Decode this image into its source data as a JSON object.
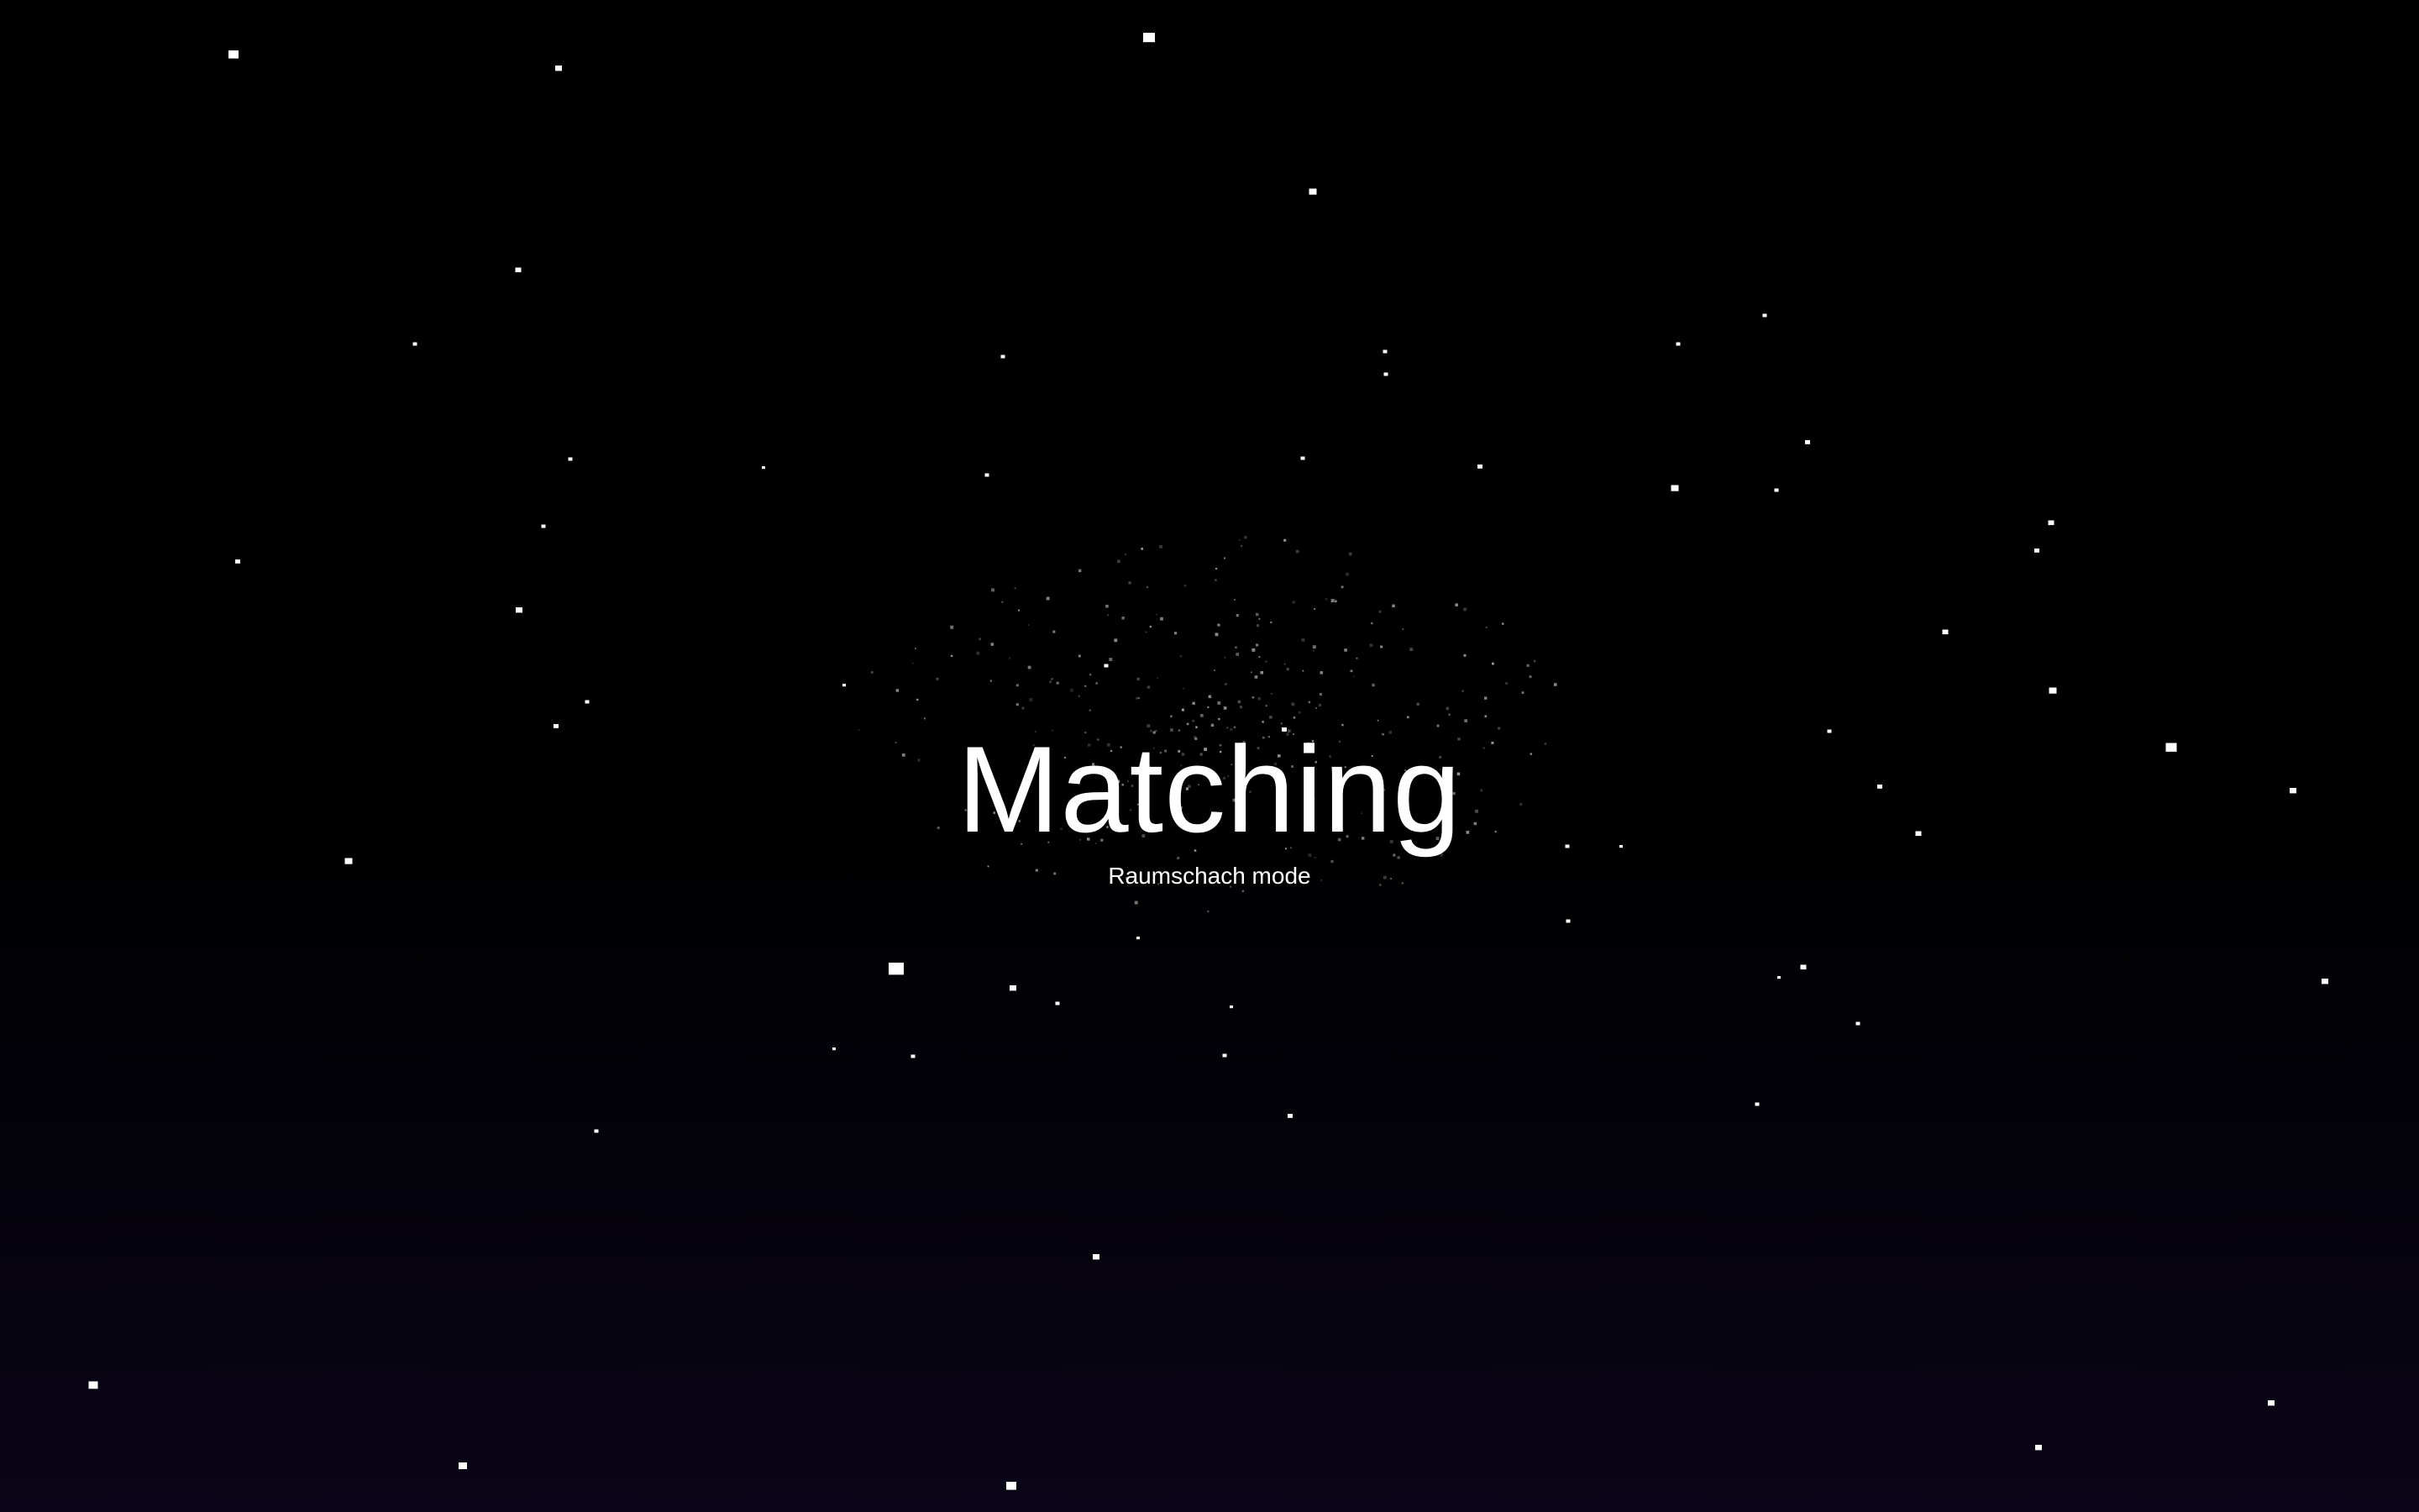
{
  "screen": {
    "title": "Matching",
    "subtitle": "Raumschach mode"
  },
  "theme": {
    "background_top": "#000000",
    "background_bottom": "#0a0518",
    "text_color": "#ffffff",
    "star_color": "#ffffff"
  }
}
